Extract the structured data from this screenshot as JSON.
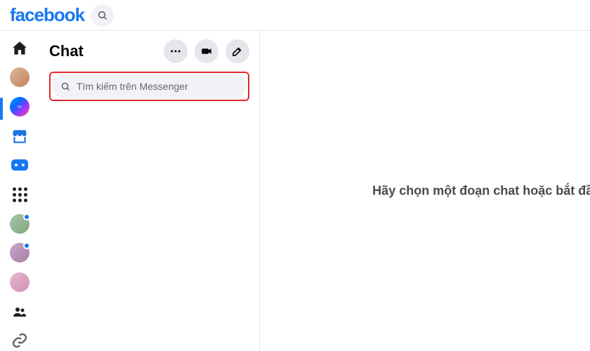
{
  "brand": "facebook",
  "topbar": {
    "search_icon": "search"
  },
  "rail": {
    "items": [
      {
        "name": "home",
        "type": "icon"
      },
      {
        "name": "profile",
        "type": "avatar"
      },
      {
        "name": "messenger",
        "type": "icon",
        "active": true
      },
      {
        "name": "marketplace",
        "type": "icon"
      },
      {
        "name": "gaming",
        "type": "icon"
      },
      {
        "name": "menu",
        "type": "icon"
      },
      {
        "name": "contact-1",
        "type": "avatar",
        "badge": true
      },
      {
        "name": "contact-2",
        "type": "avatar",
        "badge": true
      },
      {
        "name": "contact-3",
        "type": "avatar"
      },
      {
        "name": "groups",
        "type": "icon"
      },
      {
        "name": "link",
        "type": "icon"
      }
    ]
  },
  "chat": {
    "title": "Chat",
    "actions": {
      "more": "…",
      "video": "video",
      "compose": "compose"
    },
    "search_placeholder": "Tìm kiếm trên Messenger"
  },
  "main": {
    "empty_message": "Hãy chọn một đoạn chat hoặc bắt đầu c"
  },
  "colors": {
    "brand": "#1877f2",
    "highlight_border": "#e0282e",
    "bg_muted": "#f0f2f5",
    "icon_gray": "#65676b"
  }
}
